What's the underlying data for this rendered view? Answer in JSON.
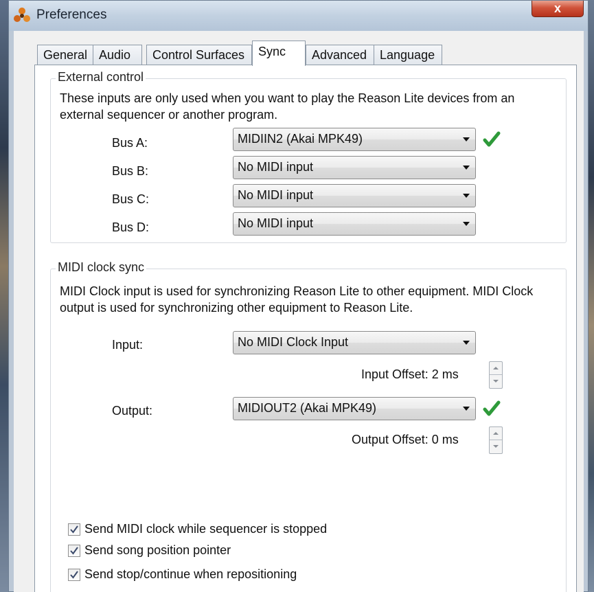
{
  "window": {
    "title": "Preferences",
    "close_glyph": "x"
  },
  "tabs": [
    {
      "label": "General"
    },
    {
      "label": "Audio"
    },
    {
      "label": "Control Surfaces"
    },
    {
      "label": "Sync"
    },
    {
      "label": "Advanced"
    },
    {
      "label": "Language"
    }
  ],
  "active_tab": "Sync",
  "external_control": {
    "legend": "External control",
    "description_line1": "These inputs are only used when you want to play the Reason Lite devices from an",
    "description_line2": "external sequencer or another program.",
    "buses": [
      {
        "label": "Bus A:",
        "value": "MIDIIN2 (Akai MPK49)",
        "status": "check"
      },
      {
        "label": "Bus B:",
        "value": "No MIDI input"
      },
      {
        "label": "Bus C:",
        "value": "No MIDI input"
      },
      {
        "label": "Bus D:",
        "value": "No MIDI input"
      }
    ]
  },
  "midi_clock_sync": {
    "legend": "MIDI clock sync",
    "description_line1": "MIDI Clock input is used for synchronizing Reason Lite to other equipment. MIDI Clock",
    "description_line2": "output is used for synchronizing other equipment to Reason Lite.",
    "input": {
      "label": "Input:",
      "value": "No MIDI Clock Input"
    },
    "input_offset": "Input Offset: 2 ms",
    "output": {
      "label": "Output:",
      "value": "MIDIOUT2 (Akai MPK49)",
      "status": "check"
    },
    "output_offset": "Output Offset: 0 ms"
  },
  "options": [
    {
      "label": "Send MIDI clock while sequencer is stopped",
      "checked": true
    },
    {
      "label": "Send song position pointer",
      "checked": true
    },
    {
      "label": "Send stop/continue when repositioning",
      "checked": true
    }
  ],
  "colors": {
    "check_green": "#2e9a3a",
    "close_red": "#c9442b"
  }
}
